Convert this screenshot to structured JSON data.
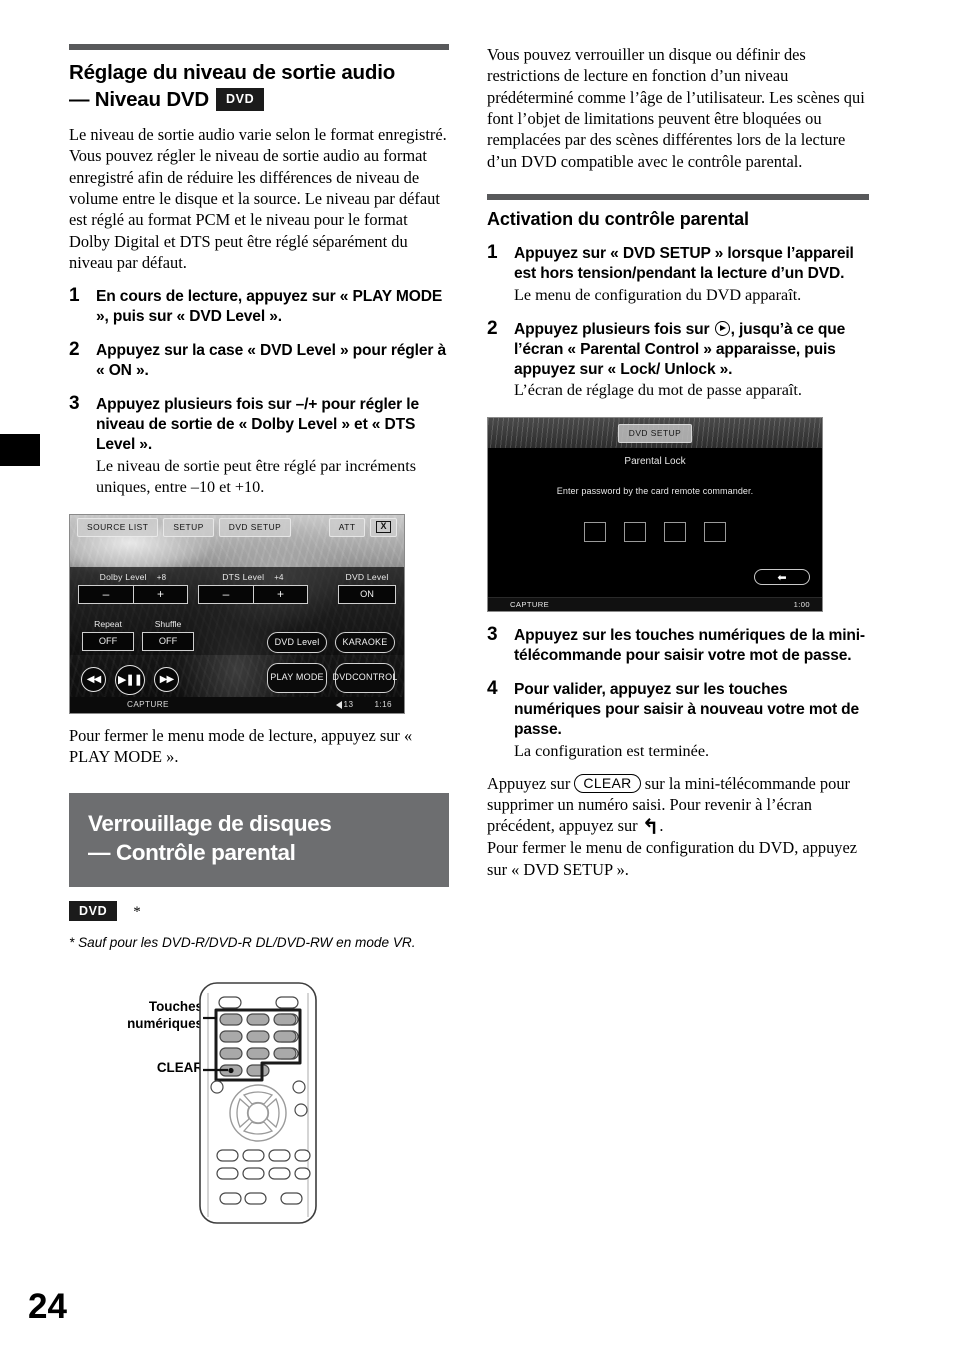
{
  "page": {
    "number": "24"
  },
  "left": {
    "section1": {
      "title_line1": "Réglage du niveau de sortie audio",
      "title_line2": "— Niveau DVD",
      "badge": "DVD",
      "intro": "Le niveau de sortie audio varie selon le format enregistré. Vous pouvez régler le niveau de sortie audio au format enregistré afin de réduire les différences de niveau de volume entre le disque et la source. Le niveau par défaut est réglé au format PCM et le niveau pour le format Dolby Digital et DTS peut être réglé séparément du niveau par défaut.",
      "steps": [
        {
          "num": "1",
          "head": "En cours de lecture, appuyez sur « PLAY MODE », puis sur « DVD Level ».",
          "sub": ""
        },
        {
          "num": "2",
          "head": "Appuyez sur la case « DVD Level » pour régler à « ON ».",
          "sub": ""
        },
        {
          "num": "3",
          "head": "Appuyez plusieurs fois sur –/+ pour régler le niveau de sortie de « Dolby Level » et « DTS Level ».",
          "sub": "Le niveau de sortie peut être réglé par incréments uniques, entre –10 et +10."
        }
      ],
      "closing": "Pour fermer le menu mode de lecture, appuyez sur « PLAY MODE »."
    },
    "player_ui": {
      "tabs": [
        "SOURCE LIST",
        "SETUP",
        "DVD SETUP"
      ],
      "att_label": "ATT",
      "close_label": "X",
      "dolby": {
        "label": "Dolby Level",
        "value": "+8",
        "minus": "–",
        "plus": "+"
      },
      "dts": {
        "label": "DTS Level",
        "value": "+4",
        "minus": "–",
        "plus": "+"
      },
      "dvd_level": {
        "label": "DVD Level",
        "state": "ON"
      },
      "repeat": {
        "label": "Repeat",
        "state": "OFF"
      },
      "shuffle": {
        "label": "Shuffle",
        "state": "OFF"
      },
      "pill_dvd_level": "DVD Level",
      "pill_karaoke": "KARAOKE",
      "transport": {
        "prev": "◀◀",
        "play_pause": "▶❚❚",
        "next": "▶▶"
      },
      "pill_play_mode": "PLAY MODE",
      "pill_dvd_control_l1": "DVD",
      "pill_dvd_control_l2": "CONTROL",
      "status_capture": "CAPTURE",
      "status_volume": "13",
      "status_time": "1:16"
    },
    "banner": {
      "line1": "Verrouillage de disques",
      "line2": "— Contrôle parental",
      "badge": "DVD",
      "star": "*",
      "footnote": "* Sauf pour les DVD-R/DVD-R DL/DVD-RW en mode VR."
    },
    "remote": {
      "label_keys_l1": "Touches",
      "label_keys_l2": "numériques",
      "label_clear": "CLEAR"
    }
  },
  "right": {
    "intro": "Vous pouvez verrouiller un disque ou définir des restrictions de lecture en fonction d’un niveau prédéterminé comme l’âge de l’utilisateur. Les scènes qui font l’objet de limitations peuvent être bloquées ou remplacées par des scènes différentes lors de la lecture d’un DVD compatible avec le contrôle parental.",
    "subsection_title": "Activation du contrôle parental",
    "steps": [
      {
        "num": "1",
        "head": "Appuyez sur « DVD SETUP » lorsque l’appareil est hors tension/pendant la lecture d’un DVD.",
        "sub": "Le menu de configuration du DVD apparaît."
      },
      {
        "num": "2",
        "head_a": "Appuyez plusieurs fois sur ",
        "head_b": ", jusqu’à ce que l’écran « Parental Control » apparaisse, puis appuyez sur « Lock/ Unlock ».",
        "sub": "L’écran de réglage du mot de passe apparaît."
      },
      {
        "num": "3",
        "head": "Appuyez sur les touches numériques de la mini-télécommande pour saisir votre mot de passe.",
        "sub": ""
      },
      {
        "num": "4",
        "head": "Pour valider, appuyez sur les touches numériques pour saisir à nouveau votre mot de passe.",
        "sub": "La configuration est terminée."
      }
    ],
    "parental_ui": {
      "tab": "DVD SETUP",
      "title": "Parental Lock",
      "message": "Enter password by the card remote commander.",
      "back_icon": "⬅",
      "status_capture": "CAPTURE",
      "status_time": "1:00"
    },
    "closing": {
      "p1_a": "Appuyez sur ",
      "p1_clear": "CLEAR",
      "p1_b": " sur la mini-télécommande pour supprimer un numéro saisi. Pour revenir à l’écran précédent, appuyez sur ",
      "p1_return": "↰",
      "p1_c": ".",
      "p2": "Pour fermer le menu de configuration du DVD, appuyez sur « DVD SETUP »."
    }
  }
}
